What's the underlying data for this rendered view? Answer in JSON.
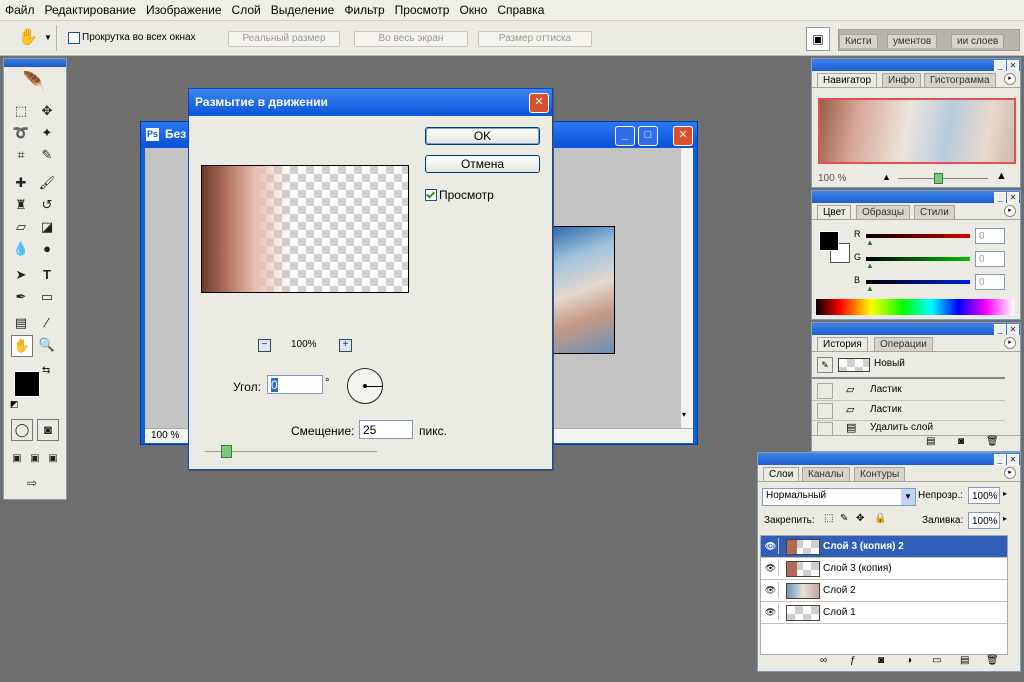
{
  "menu": [
    "Файл",
    "Редактирование",
    "Изображение",
    "Слой",
    "Выделение",
    "Фильтр",
    "Просмотр",
    "Окно",
    "Справка"
  ],
  "options": {
    "scroll_all_label": "Прокрутка во всех окнах",
    "actual_size": "Реальный размер",
    "fit_screen": "Во весь экран",
    "print_size": "Размер оттиска",
    "well_tabs": [
      "Кисти",
      "ументов",
      "ии слоев"
    ]
  },
  "document": {
    "title": "Без",
    "zoom": "100 %"
  },
  "dialog": {
    "title": "Размытие в движении",
    "ok": "OK",
    "cancel": "Отмена",
    "preview_label": "Просмотр",
    "zoom": "100%",
    "angle_label": "Угол:",
    "angle_value": "0",
    "degree": "°",
    "distance_label": "Смещение:",
    "distance_value": "25",
    "distance_unit": "пикс.",
    "distance_slider_fraction": 0.12
  },
  "navigator": {
    "tabs": [
      "Навигатор",
      "Инфо",
      "Гистограмма"
    ],
    "zoom": "100 %"
  },
  "color": {
    "tabs": [
      "Цвет",
      "Образцы",
      "Стили"
    ],
    "channels": [
      {
        "name": "R",
        "value": "0",
        "color": "#d40000"
      },
      {
        "name": "G",
        "value": "0",
        "color": "#00c000"
      },
      {
        "name": "B",
        "value": "0",
        "color": "#0020e0"
      }
    ]
  },
  "history": {
    "tabs": [
      "История",
      "Операции"
    ],
    "snapshot": "Новый",
    "items": [
      "Ластик",
      "Ластик",
      "Удалить слой"
    ]
  },
  "layers": {
    "tabs": [
      "Слои",
      "Каналы",
      "Контуры"
    ],
    "blend_mode": "Нормальный",
    "opacity_label": "Непрозр.:",
    "opacity_value": "100%",
    "lock_label": "Закрепить:",
    "fill_label": "Заливка:",
    "fill_value": "100%",
    "items": [
      {
        "name": "Слой 3 (копия) 2",
        "selected": true
      },
      {
        "name": "Слой 3 (копия)",
        "selected": false
      },
      {
        "name": "Слой 2",
        "selected": false
      },
      {
        "name": "Слой 1",
        "selected": false
      }
    ]
  },
  "colors": {
    "accent": "#2f5fb6",
    "titlebar": "#0a54d9",
    "close": "#d9502a"
  }
}
